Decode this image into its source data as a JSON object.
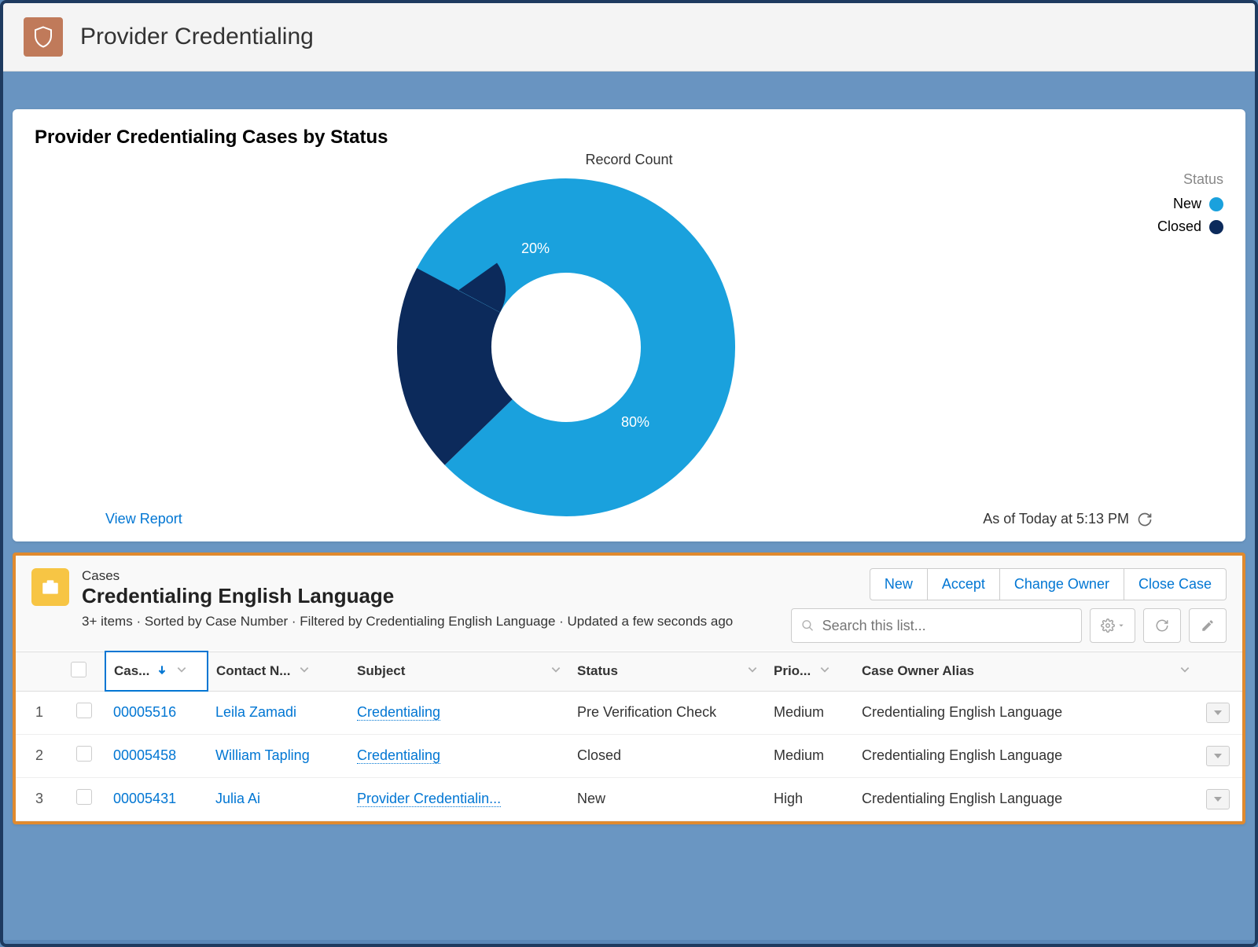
{
  "app": {
    "title": "Provider Credentialing"
  },
  "chart": {
    "title": "Provider Credentialing Cases by Status",
    "subtitle": "Record Count",
    "legend_title": "Status",
    "view_report": "View Report",
    "as_of": "As of Today at 5:13 PM"
  },
  "chart_data": {
    "type": "pie",
    "title": "Provider Credentialing Cases by Status",
    "subtitle": "Record Count",
    "series": [
      {
        "name": "New",
        "value": 80,
        "label": "80%",
        "color": "#1aa1dd"
      },
      {
        "name": "Closed",
        "value": 20,
        "label": "20%",
        "color": "#0c2a5b"
      }
    ],
    "donut": true
  },
  "list": {
    "object": "Cases",
    "view": "Credentialing English Language",
    "meta": "3+ items · Sorted by Case Number · Filtered by Credentialing English Language · Updated a few seconds ago",
    "actions": {
      "new": "New",
      "accept": "Accept",
      "change_owner": "Change Owner",
      "close_case": "Close Case"
    },
    "search_placeholder": "Search this list...",
    "columns": {
      "case": "Cas...",
      "contact": "Contact N...",
      "subject": "Subject",
      "status": "Status",
      "priority": "Prio...",
      "owner": "Case Owner Alias"
    },
    "rows": [
      {
        "n": "1",
        "case": "00005516",
        "contact": "Leila Zamadi",
        "subject": "Credentialing",
        "status": "Pre Verification Check",
        "priority": "Medium",
        "owner": "Credentialing English Language"
      },
      {
        "n": "2",
        "case": "00005458",
        "contact": "William Tapling",
        "subject": "Credentialing",
        "status": "Closed",
        "priority": "Medium",
        "owner": "Credentialing English Language"
      },
      {
        "n": "3",
        "case": "00005431",
        "contact": "Julia Ai",
        "subject": "Provider Credentialin...",
        "status": "New",
        "priority": "High",
        "owner": "Credentialing English Language"
      }
    ]
  }
}
